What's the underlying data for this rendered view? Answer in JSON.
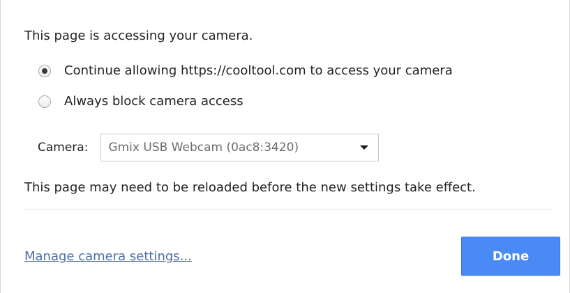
{
  "dialog": {
    "heading": "This page is accessing your camera.",
    "options": [
      {
        "label": "Continue allowing https://cooltool.com to access your camera",
        "selected": true
      },
      {
        "label": "Always block camera access",
        "selected": false
      }
    ],
    "camera": {
      "label": "Camera:",
      "selected_value": "Gmix USB Webcam (0ac8:3420)"
    },
    "note": "This page may need to be reloaded before the new settings take effect.",
    "manage_link": "Manage camera settings...",
    "done_label": "Done"
  },
  "colors": {
    "accent": "#4a8af4",
    "link": "#4d6ea6",
    "text": "#222222"
  }
}
